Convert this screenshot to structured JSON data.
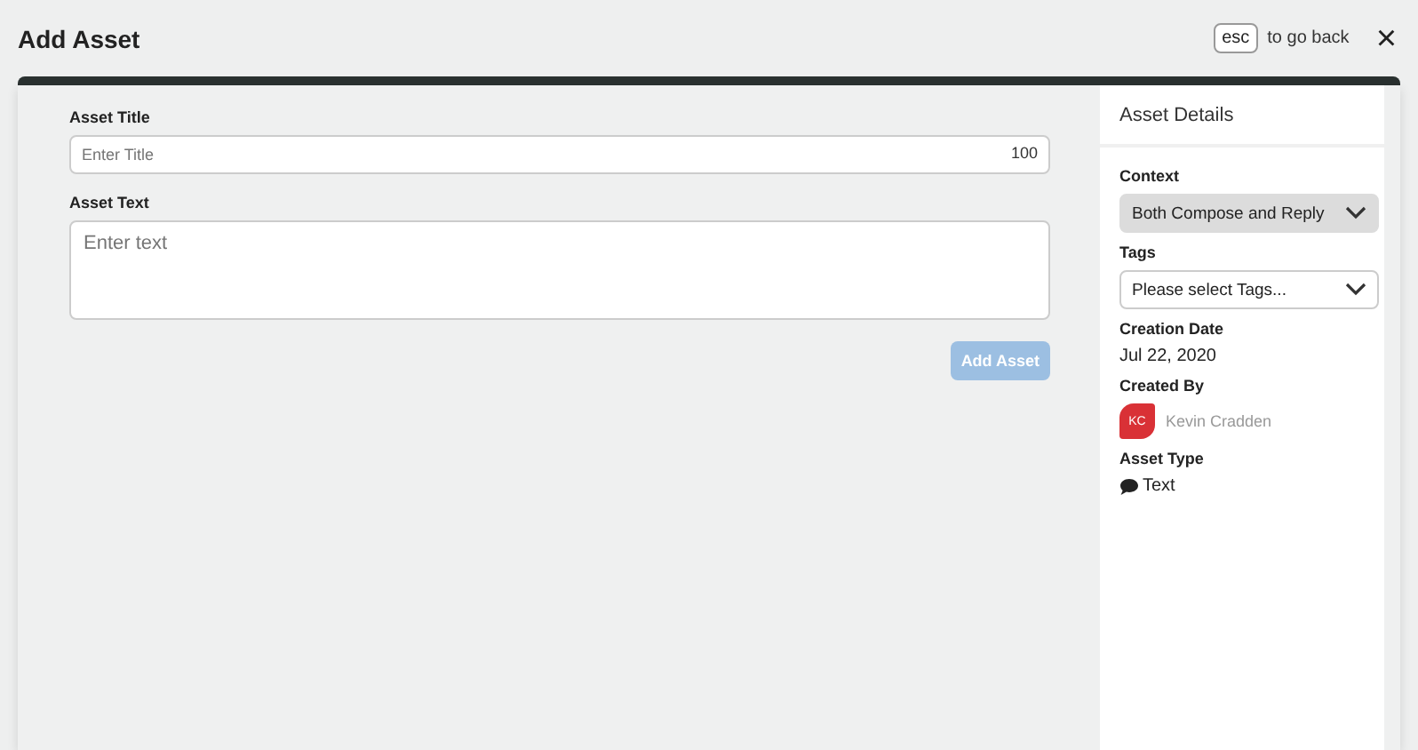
{
  "header": {
    "title": "Add Asset",
    "shortcut_key": "esc",
    "shortcut_hint": "to go back",
    "close": "×"
  },
  "form": {
    "title_label": "Asset Title",
    "title_placeholder": "Enter Title",
    "title_counter": "100",
    "text_label": "Asset Text",
    "text_placeholder": "Enter text",
    "submit": {
      "label": "Add Asset",
      "disabled": true
    }
  },
  "details": {
    "heading": "Asset Details",
    "context": {
      "label": "Context",
      "value": "Both Compose and Reply",
      "disabled": true
    },
    "tags": {
      "label": "Tags",
      "placeholder": "Please select Tags...",
      "disabled": false
    },
    "creation_date": {
      "label": "Creation Date",
      "value": "Jul 22, 2020"
    },
    "created_by": {
      "label": "Created By",
      "initials": "KC",
      "name": "Kevin Cradden"
    },
    "asset_type": {
      "label": "Asset Type",
      "value": "Text"
    }
  }
}
